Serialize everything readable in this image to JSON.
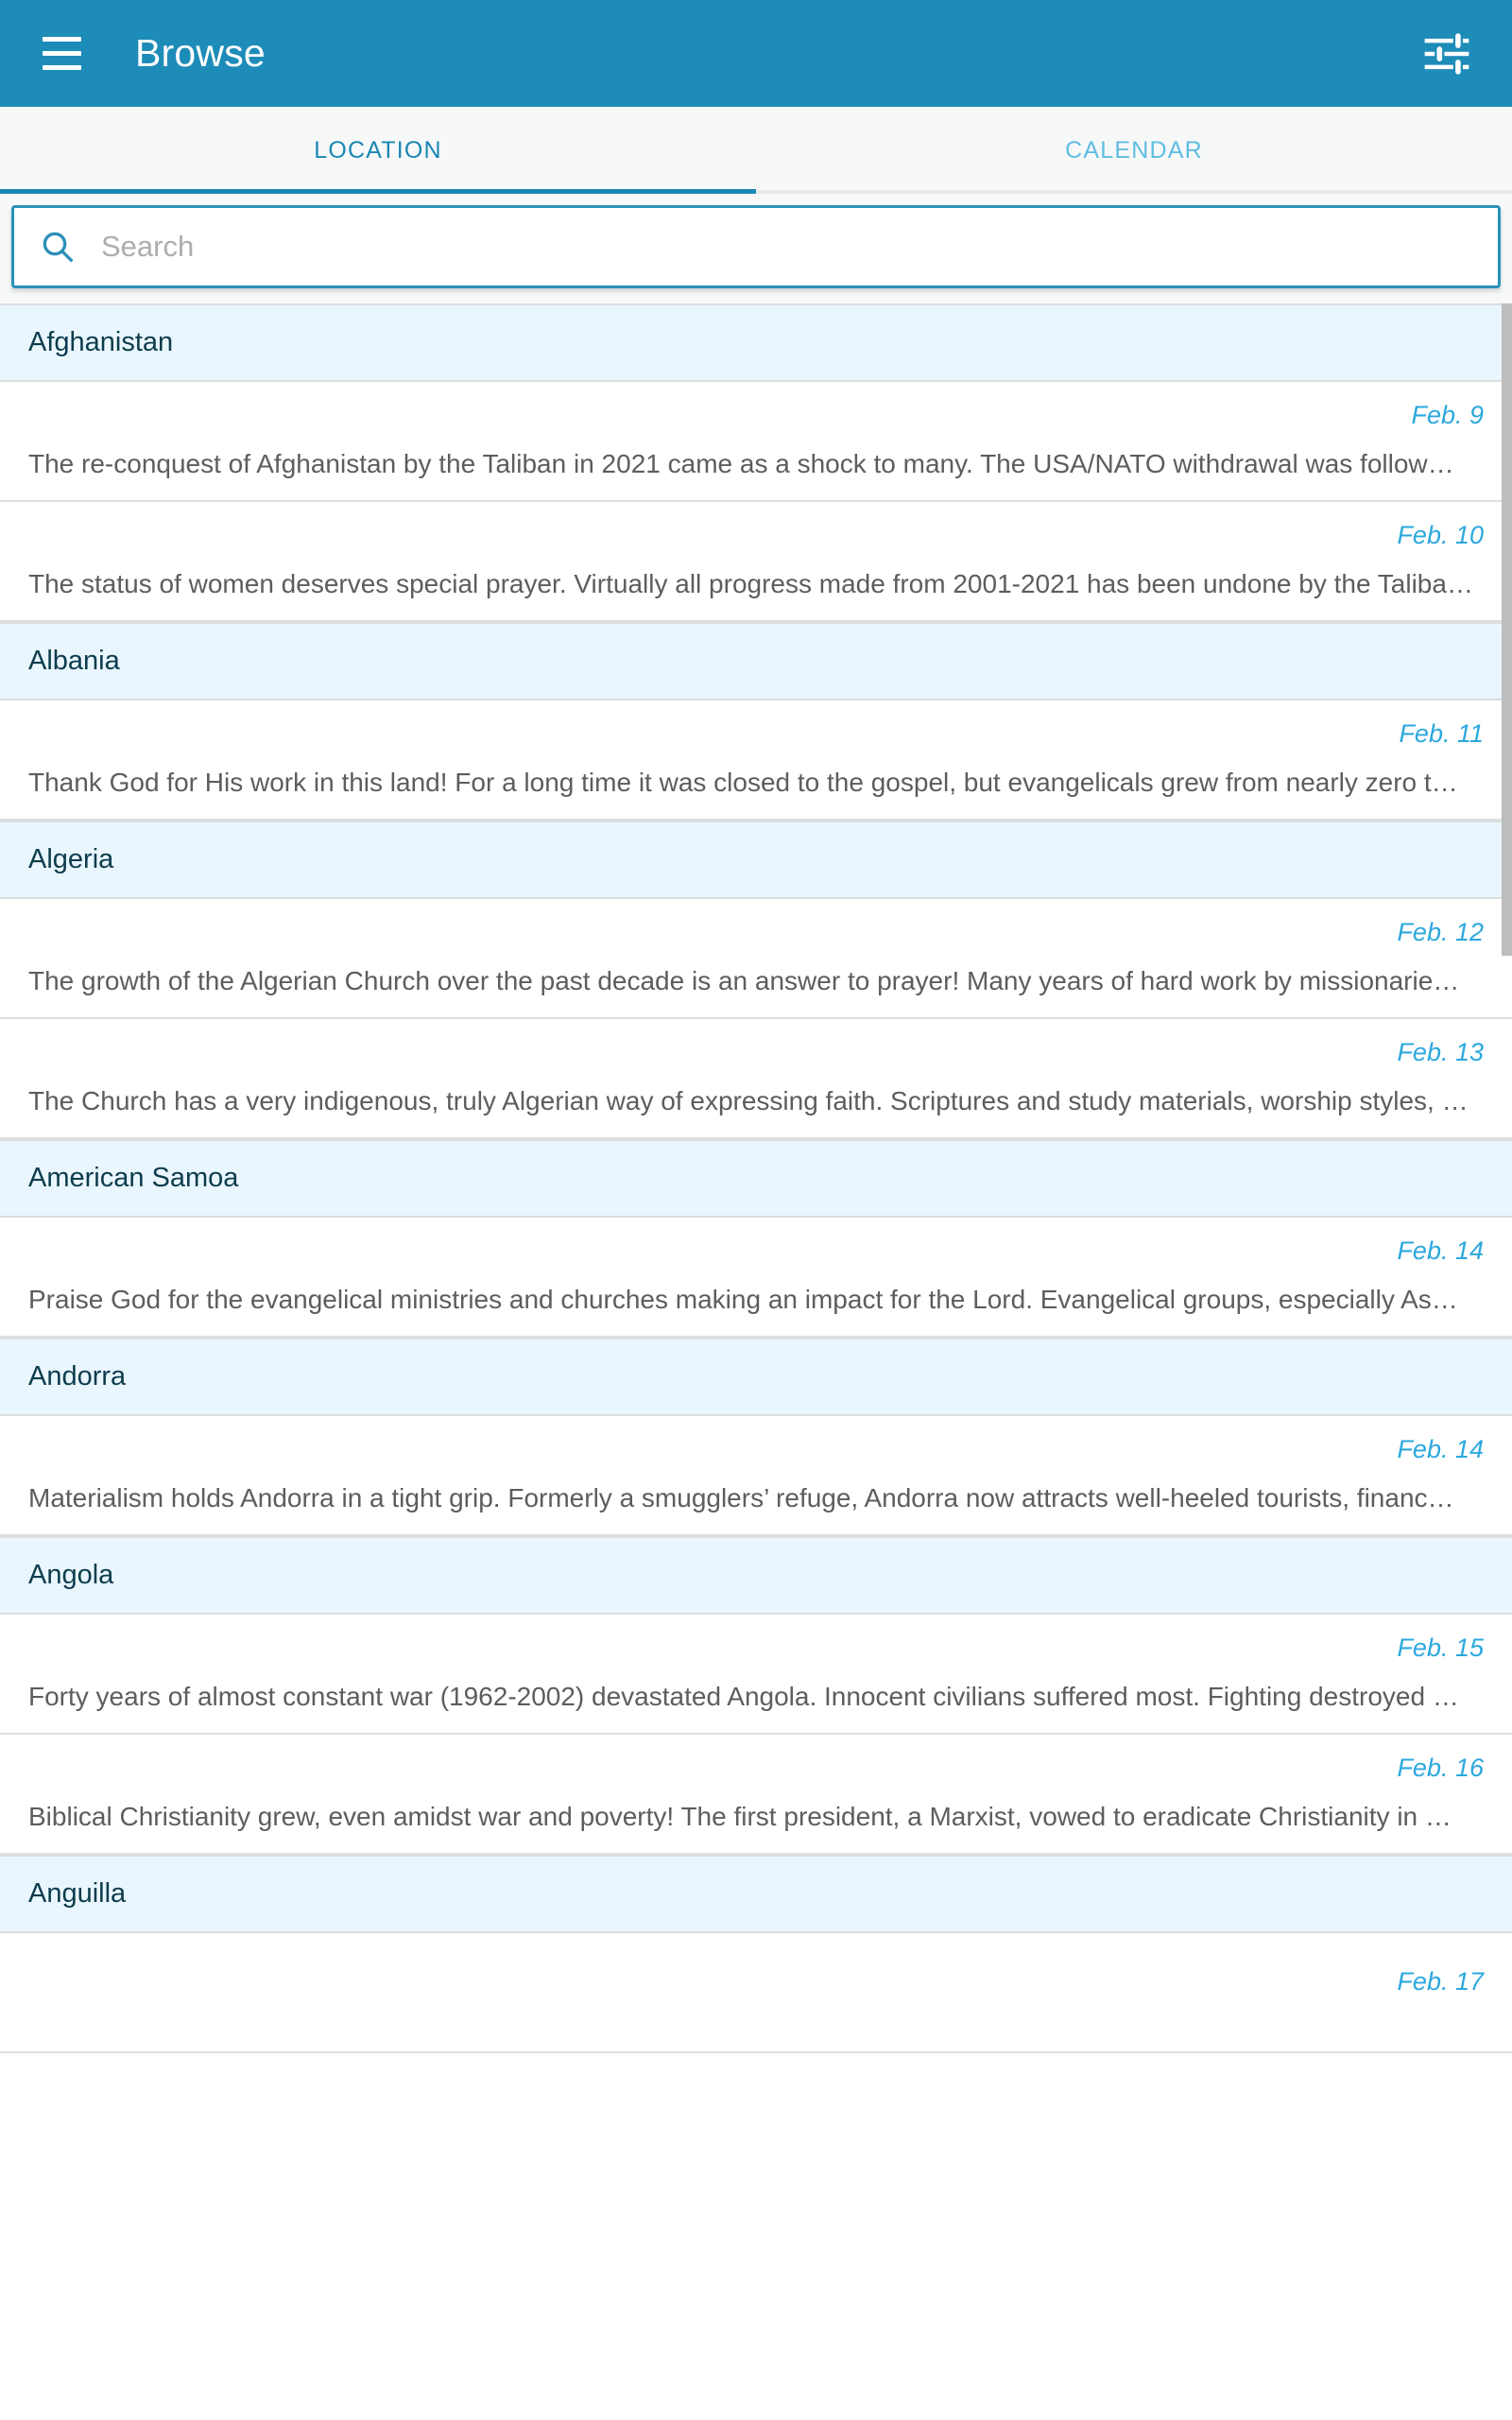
{
  "appbar": {
    "title": "Browse",
    "menu_icon": "hamburger-menu-icon",
    "filter_icon": "tune-filter-icon",
    "background": "#1d8cb8"
  },
  "tabs": {
    "active_index": 0,
    "items": [
      {
        "label": "LOCATION",
        "active": true
      },
      {
        "label": "CALENDAR",
        "active": false
      }
    ],
    "active_color": "#1b87b4",
    "inactive_color": "#5fbde2"
  },
  "search": {
    "placeholder": "Search",
    "value": "",
    "icon": "search-icon",
    "border_color": "#2b90b8"
  },
  "list": {
    "section_bg": "#e9f6fd",
    "date_color": "#2ba8dd",
    "sections": [
      {
        "name": "Afghanistan",
        "entries": [
          {
            "date": "Feb. 9",
            "body": "The re-conquest of Afghanistan by the Taliban in 2021 came as a shock to many. The USA/NATO withdrawal was follow…"
          },
          {
            "date": "Feb. 10",
            "body": "The status of women deserves special prayer. Virtually all progress made from 2001-2021 has been undone by the Taliba…"
          }
        ]
      },
      {
        "name": "Albania",
        "entries": [
          {
            "date": "Feb. 11",
            "body": "Thank God for His work in this land! For a long time it was closed to the gospel, but evangelicals grew from nearly zero t…"
          }
        ]
      },
      {
        "name": "Algeria",
        "entries": [
          {
            "date": "Feb. 12",
            "body": "The growth of the Algerian Church over the past decade is an answer to prayer! Many years of hard work by missionarie…"
          },
          {
            "date": "Feb. 13",
            "body": "The Church has a very indigenous, truly Algerian way of expressing faith. Scriptures and study materials, worship styles, …"
          }
        ]
      },
      {
        "name": "American Samoa",
        "entries": [
          {
            "date": "Feb. 14",
            "body": "Praise God for the evangelical ministries and churches making an impact for the Lord. Evangelical groups, especially As…"
          }
        ]
      },
      {
        "name": "Andorra",
        "entries": [
          {
            "date": "Feb. 14",
            "body": "Materialism holds Andorra in a tight grip. Formerly a smugglers’ refuge, Andorra now attracts well-heeled tourists, financ…"
          }
        ]
      },
      {
        "name": "Angola",
        "entries": [
          {
            "date": "Feb. 15",
            "body": "Forty years of almost constant war (1962-2002) devastated Angola. Innocent civilians suffered most. Fighting destroyed …"
          },
          {
            "date": "Feb. 16",
            "body": "Biblical Christianity grew, even amidst war and poverty! The first president, a Marxist, vowed to eradicate Christianity in …"
          }
        ]
      },
      {
        "name": "Anguilla",
        "entries": [
          {
            "date": "Feb. 17",
            "body": ""
          }
        ]
      }
    ]
  },
  "scrollbar": {
    "name": "vertical-scrollbar"
  }
}
